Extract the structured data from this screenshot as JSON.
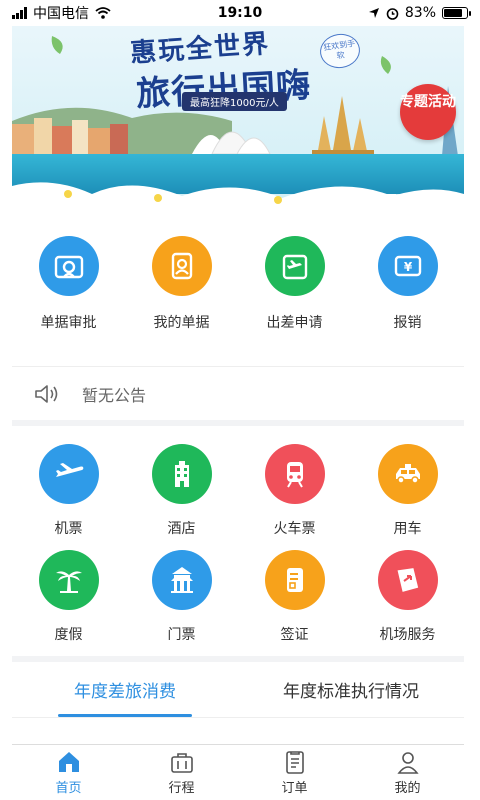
{
  "status_bar": {
    "carrier": "中国电信",
    "time": "19:10",
    "battery": "83%",
    "battery_fraction": 0.83
  },
  "banner": {
    "title": "惠玩全世界",
    "subtitle": "旅行出国嗨",
    "note": "狂欢到手软",
    "price": "最高狂降1000元/人",
    "tag": "专题活动"
  },
  "quick_actions": [
    {
      "label": "单据审批",
      "icon": "approval-icon",
      "color": "#2f9be8"
    },
    {
      "label": "我的单据",
      "icon": "my-document-icon",
      "color": "#f7a21b"
    },
    {
      "label": "出差申请",
      "icon": "business-trip-icon",
      "color": "#1fb85a"
    },
    {
      "label": "报销",
      "icon": "reimbursement-icon",
      "color": "#2f9be8"
    }
  ],
  "notice": {
    "text": "暂无公告",
    "icon": "speaker-icon"
  },
  "services": [
    {
      "label": "机票",
      "icon": "airplane-icon",
      "color": "#2f9be8"
    },
    {
      "label": "酒店",
      "icon": "hotel-icon",
      "color": "#1fb85a"
    },
    {
      "label": "火车票",
      "icon": "train-icon",
      "color": "#f0505a"
    },
    {
      "label": "用车",
      "icon": "taxi-icon",
      "color": "#f7a21b"
    },
    {
      "label": "度假",
      "icon": "palm-tree-icon",
      "color": "#1fb85a"
    },
    {
      "label": "门票",
      "icon": "temple-icon",
      "color": "#2f9be8"
    },
    {
      "label": "签证",
      "icon": "visa-icon",
      "color": "#f7a21b"
    },
    {
      "label": "机场服务",
      "icon": "airport-service-icon",
      "color": "#f0505a"
    }
  ],
  "stats_tabs": [
    {
      "label": "年度差旅消费",
      "active": true
    },
    {
      "label": "年度标准执行情况",
      "active": false
    }
  ],
  "bottom_nav": [
    {
      "label": "首页",
      "icon": "home-icon",
      "active": true
    },
    {
      "label": "行程",
      "icon": "suitcase-icon",
      "active": false
    },
    {
      "label": "订单",
      "icon": "order-icon",
      "active": false
    },
    {
      "label": "我的",
      "icon": "profile-icon",
      "active": false
    }
  ],
  "colors": {
    "accent": "#2e8fe0",
    "divider": "#f2f3f5"
  }
}
